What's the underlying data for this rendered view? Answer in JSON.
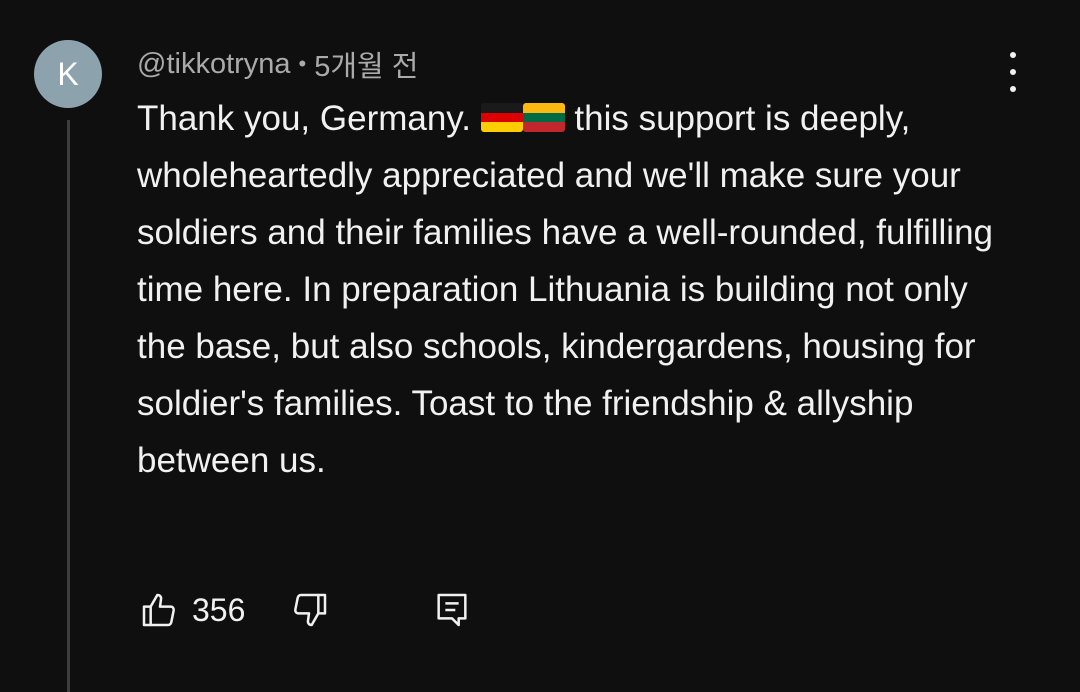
{
  "comment": {
    "avatar_letter": "K",
    "author": "@tikkotryna",
    "separator": "•",
    "time_ago": "5개월 전",
    "text_part1": "Thank you, Germany.",
    "flags": [
      "germany-flag-icon",
      "lithuania-flag-icon"
    ],
    "text_part2": "this support is deeply, wholeheartedly appreciated and we'll make sure your soldiers and their families have a well-rounded, fulfilling time here. In preparation Lithuania is building not only the base, but also schools, kindergardens, housing for soldier's families. Toast to the friendship & allyship between us.",
    "like_count": "356"
  },
  "icons": {
    "like": "thumbs-up-icon",
    "dislike": "thumbs-down-icon",
    "reply": "reply-icon",
    "menu": "more-vertical-icon"
  },
  "colors": {
    "background": "#0f0f0f",
    "avatar": "#8ca3ae",
    "text": "#f1f1f1",
    "secondary_text": "#aaaaaa"
  }
}
